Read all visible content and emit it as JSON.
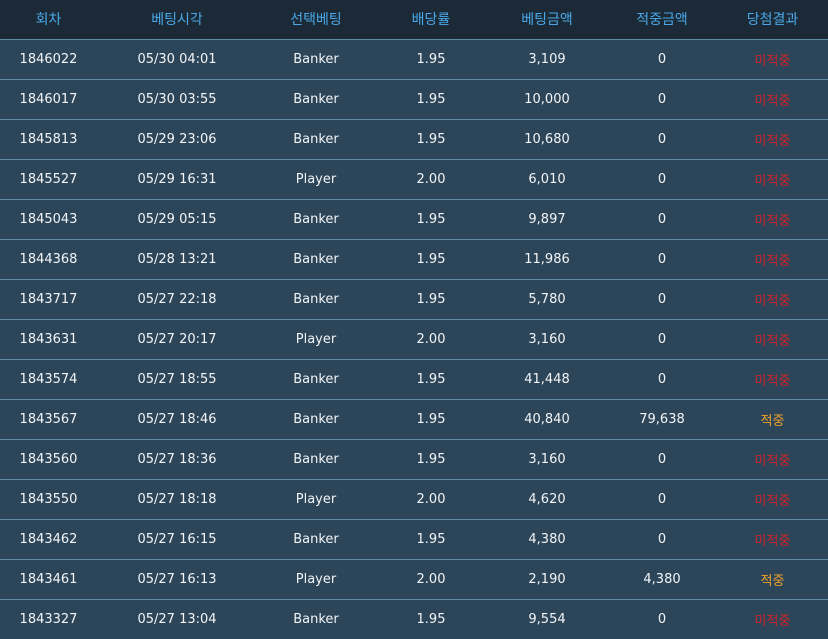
{
  "headers": [
    "회차",
    "베팅시각",
    "선택베팅",
    "배당률",
    "베팅금액",
    "적중금액",
    "당첨결과"
  ],
  "colors": {
    "header_bg": "#1b2a36",
    "header_text": "#4aa8e8",
    "row_bg": "#2d4558",
    "row_divider": "#5f8aa3",
    "cell_text": "#f2f5f7",
    "lose": "#d2232a",
    "win": "#f0a52a"
  },
  "rows": [
    {
      "round": "1846022",
      "time": "05/30 04:01",
      "pick": "Banker",
      "odds": "1.95",
      "bet": "3,109",
      "payout": "0",
      "result": "미적중",
      "status": "lose"
    },
    {
      "round": "1846017",
      "time": "05/30 03:55",
      "pick": "Banker",
      "odds": "1.95",
      "bet": "10,000",
      "payout": "0",
      "result": "미적중",
      "status": "lose"
    },
    {
      "round": "1845813",
      "time": "05/29 23:06",
      "pick": "Banker",
      "odds": "1.95",
      "bet": "10,680",
      "payout": "0",
      "result": "미적중",
      "status": "lose"
    },
    {
      "round": "1845527",
      "time": "05/29 16:31",
      "pick": "Player",
      "odds": "2.00",
      "bet": "6,010",
      "payout": "0",
      "result": "미적중",
      "status": "lose"
    },
    {
      "round": "1845043",
      "time": "05/29 05:15",
      "pick": "Banker",
      "odds": "1.95",
      "bet": "9,897",
      "payout": "0",
      "result": "미적중",
      "status": "lose"
    },
    {
      "round": "1844368",
      "time": "05/28 13:21",
      "pick": "Banker",
      "odds": "1.95",
      "bet": "11,986",
      "payout": "0",
      "result": "미적중",
      "status": "lose"
    },
    {
      "round": "1843717",
      "time": "05/27 22:18",
      "pick": "Banker",
      "odds": "1.95",
      "bet": "5,780",
      "payout": "0",
      "result": "미적중",
      "status": "lose"
    },
    {
      "round": "1843631",
      "time": "05/27 20:17",
      "pick": "Player",
      "odds": "2.00",
      "bet": "3,160",
      "payout": "0",
      "result": "미적중",
      "status": "lose"
    },
    {
      "round": "1843574",
      "time": "05/27 18:55",
      "pick": "Banker",
      "odds": "1.95",
      "bet": "41,448",
      "payout": "0",
      "result": "미적중",
      "status": "lose"
    },
    {
      "round": "1843567",
      "time": "05/27 18:46",
      "pick": "Banker",
      "odds": "1.95",
      "bet": "40,840",
      "payout": "79,638",
      "result": "적중",
      "status": "win"
    },
    {
      "round": "1843560",
      "time": "05/27 18:36",
      "pick": "Banker",
      "odds": "1.95",
      "bet": "3,160",
      "payout": "0",
      "result": "미적중",
      "status": "lose"
    },
    {
      "round": "1843550",
      "time": "05/27 18:18",
      "pick": "Player",
      "odds": "2.00",
      "bet": "4,620",
      "payout": "0",
      "result": "미적중",
      "status": "lose"
    },
    {
      "round": "1843462",
      "time": "05/27 16:15",
      "pick": "Banker",
      "odds": "1.95",
      "bet": "4,380",
      "payout": "0",
      "result": "미적중",
      "status": "lose"
    },
    {
      "round": "1843461",
      "time": "05/27 16:13",
      "pick": "Player",
      "odds": "2.00",
      "bet": "2,190",
      "payout": "4,380",
      "result": "적중",
      "status": "win"
    },
    {
      "round": "1843327",
      "time": "05/27 13:04",
      "pick": "Banker",
      "odds": "1.95",
      "bet": "9,554",
      "payout": "0",
      "result": "미적중",
      "status": "lose"
    }
  ]
}
